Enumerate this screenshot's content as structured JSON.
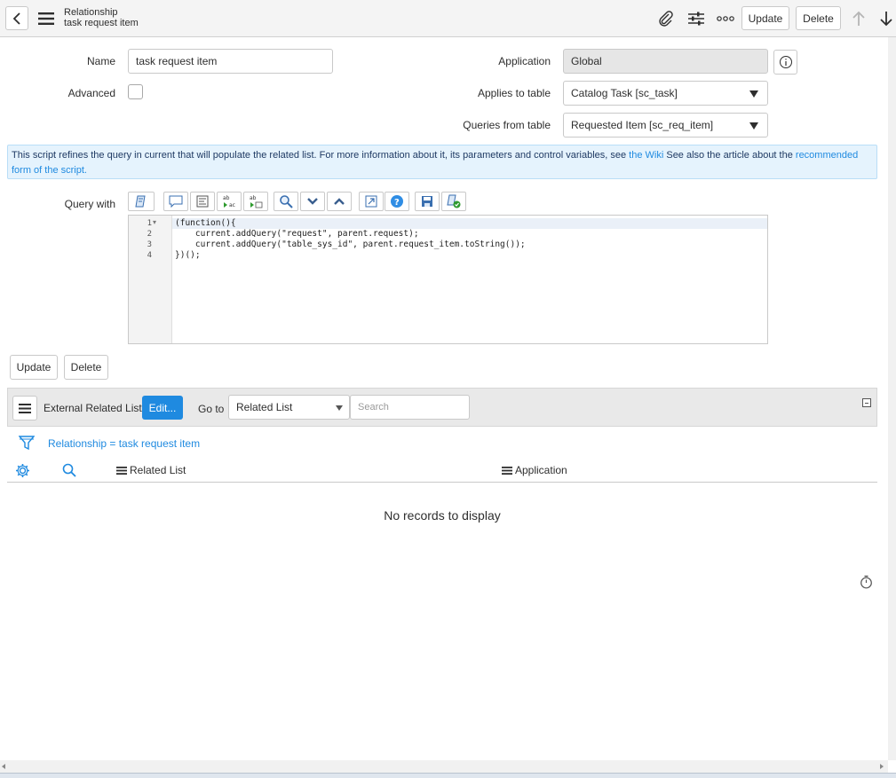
{
  "header": {
    "title": "Relationship",
    "subtitle": "task request item",
    "update_label": "Update",
    "delete_label": "Delete"
  },
  "form": {
    "name_label": "Name",
    "name_value": "task request item",
    "advanced_label": "Advanced",
    "advanced_checked": false,
    "application_label": "Application",
    "application_value": "Global",
    "applies_label": "Applies to table",
    "applies_value": "Catalog Task [sc_task]",
    "queries_label": "Queries from table",
    "queries_value": "Requested Item [sc_req_item]"
  },
  "info": {
    "text1": "This script refines the query in current that will populate the related list. For more information about it, its parameters and control variables, see ",
    "link1": "the Wiki",
    "text2": " See also the article about the ",
    "link2": "recommended form of the script."
  },
  "editor": {
    "label": "Query with",
    "line_numbers": [
      "1",
      "2",
      "3",
      "4"
    ],
    "fold_marker": "▾",
    "lines": [
      "(function(){",
      "    current.addQuery(\"request\", parent.request);",
      "    current.addQuery(\"table_sys_id\", parent.request_item.toString());",
      "})();"
    ]
  },
  "form_buttons": {
    "update": "Update",
    "delete": "Delete"
  },
  "related": {
    "bar_title": "External Related Lists",
    "edit_label": "Edit...",
    "goto_label": "Go to",
    "goto_value": "Related List",
    "search_placeholder": "Search",
    "breadcrumb": "Relationship = task request item",
    "columns": [
      "Related List",
      "Application"
    ],
    "empty_message": "No records to display"
  },
  "colors": {
    "accent": "#1f8ae0",
    "info_bg": "#e5f3fd"
  }
}
